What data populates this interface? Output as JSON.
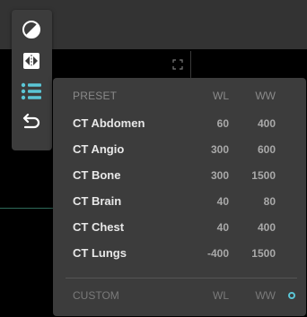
{
  "toolbar": {
    "tools": [
      {
        "icon": "contrast-icon"
      },
      {
        "icon": "flip-icon"
      },
      {
        "icon": "list-icon",
        "active": true
      },
      {
        "icon": "undo-icon"
      }
    ],
    "accent_color": "#5bc6d6"
  },
  "presets": {
    "header": {
      "name": "PRESET",
      "wl": "WL",
      "ww": "WW"
    },
    "items": [
      {
        "name": "CT Abdomen",
        "wl": "60",
        "ww": "400"
      },
      {
        "name": "CT Angio",
        "wl": "300",
        "ww": "600"
      },
      {
        "name": "CT Bone",
        "wl": "300",
        "ww": "1500"
      },
      {
        "name": "CT Brain",
        "wl": "40",
        "ww": "80"
      },
      {
        "name": "CT Chest",
        "wl": "40",
        "ww": "400"
      },
      {
        "name": "CT Lungs",
        "wl": "-400",
        "ww": "1500"
      }
    ],
    "custom": {
      "name": "CUSTOM",
      "wl": "WL",
      "ww": "WW"
    }
  }
}
